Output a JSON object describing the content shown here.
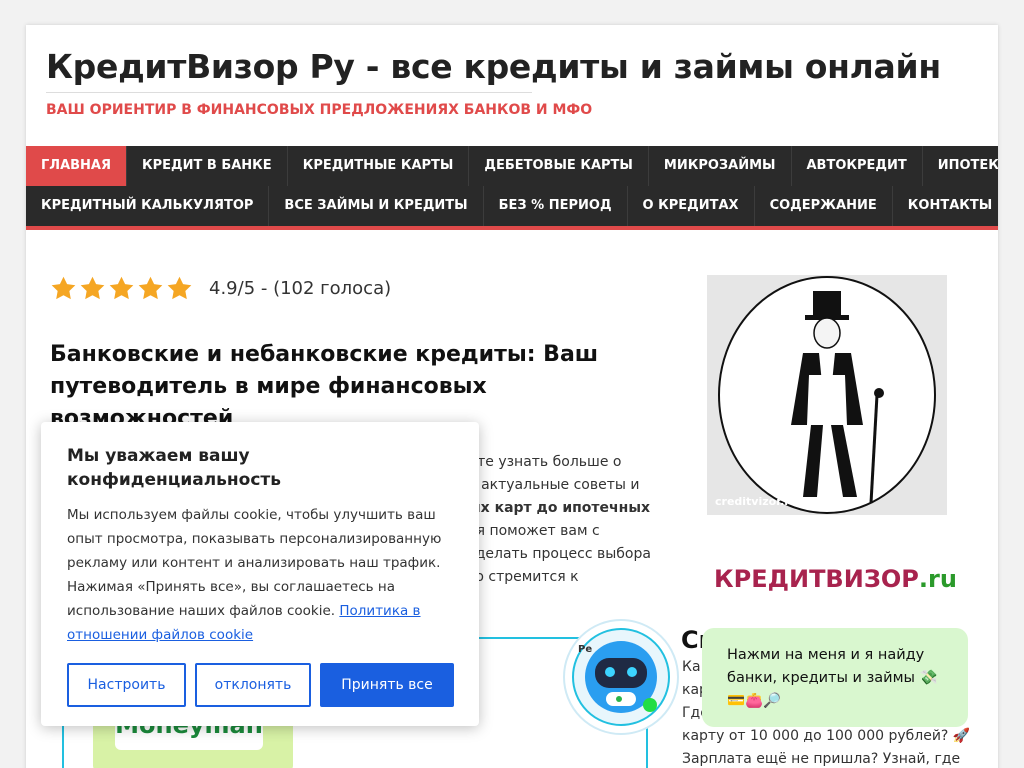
{
  "site": {
    "title": "КредитВизор Ру - все кредиты и займы онлайн",
    "tagline": "ВАШ ОРИЕНТИР В ФИНАНСОВЫХ ПРЕДЛОЖЕНИЯХ БАНКОВ И МФО"
  },
  "nav": {
    "row1": [
      "ГЛАВНАЯ",
      "КРЕДИТ В БАНКЕ",
      "КРЕДИТНЫЕ КАРТЫ",
      "ДЕБЕТОВЫЕ КАРТЫ",
      "МИКРОЗАЙМЫ",
      "АВТОКРЕДИТ",
      "ИПОТЕКА"
    ],
    "row2": [
      "КРЕДИТНЫЙ КАЛЬКУЛЯТОР",
      "ВСЕ ЗАЙМЫ И КРЕДИТЫ",
      "БЕЗ % ПЕРИОД",
      "О КРЕДИТАХ",
      "СОДЕРЖАНИЕ",
      "КОНТАКТЫ"
    ],
    "active_index": 0
  },
  "rating": {
    "stars": 5,
    "text": "4.9/5 - (102 голоса)"
  },
  "article": {
    "title": "Банковские и небанковские кредиты: Ваш путеводитель в мире финансовых возможностей",
    "intro_lines": [
      "ите узнать больше о",
      "е актуальные советы и",
      "ых карт до ипотечных",
      "ая поможет вам с",
      "сделать процесс выбора",
      "го стремится к"
    ]
  },
  "promo": {
    "logo_text": "Moneyman"
  },
  "sidebar": {
    "image_watermark": "creditvizor.ru",
    "brand_main": "КРЕДИТВИЗОР",
    "brand_tld": ".ru",
    "heading": "Сп",
    "lines": [
      "Ка",
      "кар",
      "Где",
      "карту от 10 000 до 100 000 рублей? 🚀",
      "Зарплата ещё не пришла? Узнай, где"
    ]
  },
  "cookie": {
    "title": "Мы уважаем вашу конфиденциальность",
    "body": "Мы используем файлы cookie, чтобы улучшить ваш опыт просмотра, показывать персонализированную рекламу или контент и анализировать наш трафик. Нажимая «Принять все», вы соглашаетесь на использование наших файлов cookie. ",
    "link": "Политика в отношении файлов cookie",
    "buttons": {
      "customize": "Настроить",
      "reject": "отклонять",
      "accept": "Принять все"
    }
  },
  "bot": {
    "label": "Ре"
  },
  "chat": {
    "text": "Нажми на меня и я найду банки, кредиты и займы 💸💳👛🔎"
  },
  "colors": {
    "accent_red": "#e04a4a",
    "nav_bg": "#2a2a2a",
    "cookie_blue": "#1a5fe0",
    "star": "#f5a623",
    "chat_bg": "#d9f7cf"
  }
}
